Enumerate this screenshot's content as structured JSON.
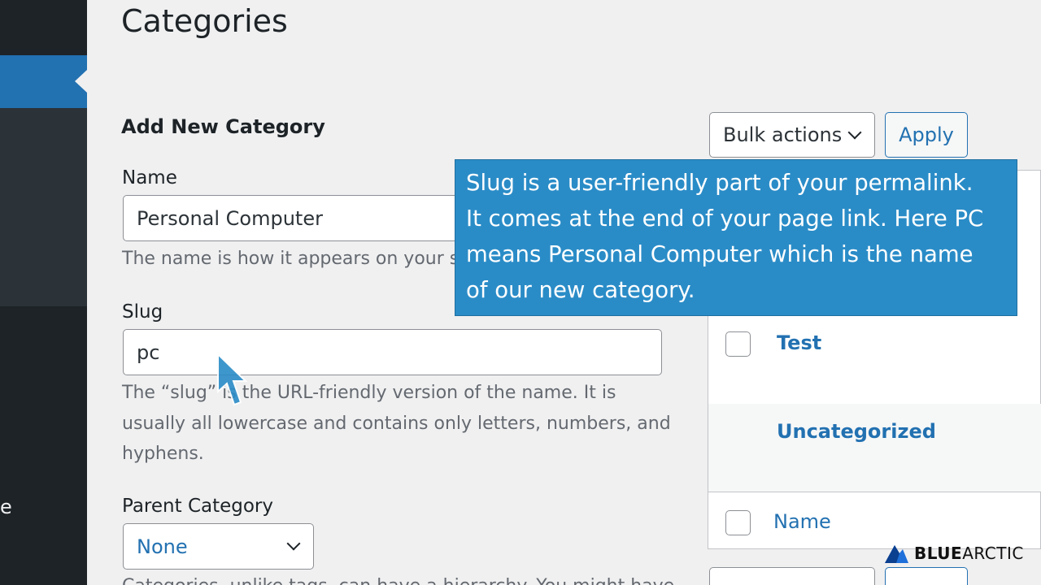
{
  "sidebar": {
    "partial_item_label": "e"
  },
  "page": {
    "title": "Categories"
  },
  "form": {
    "section_title": "Add New Category",
    "name_label": "Name",
    "name_value": "Personal Computer",
    "name_help": "The name is how it appears on your si",
    "slug_label": "Slug",
    "slug_value": "pc",
    "slug_help_1": "The “slug” is the URL-friendly version of the name. It is",
    "slug_help_2": "usually all lowercase and contains only letters, numbers, and",
    "slug_help_3": "hyphens.",
    "parent_label": "Parent Category",
    "parent_value": "None",
    "parent_help": "Categories, unlike tags, can have a hierarchy. You might have"
  },
  "list": {
    "bulk_actions_label": "Bulk actions",
    "apply_label": "Apply",
    "rows": [
      {
        "name": "Test"
      },
      {
        "name": "Uncategorized"
      }
    ],
    "footer_column": "Name"
  },
  "tooltip": {
    "lines": [
      "Slug is a user-friendly part of your permalink.",
      "It comes at the end of your page link. Here PC",
      "means Personal Computer which is the name",
      "of our new category."
    ]
  },
  "logo": {
    "part1": "BLUE",
    "part2": "ARCTIC"
  },
  "colors": {
    "accent": "#2271b1",
    "sidebar": "#1d2327",
    "tooltip": "#2a8cc7"
  }
}
